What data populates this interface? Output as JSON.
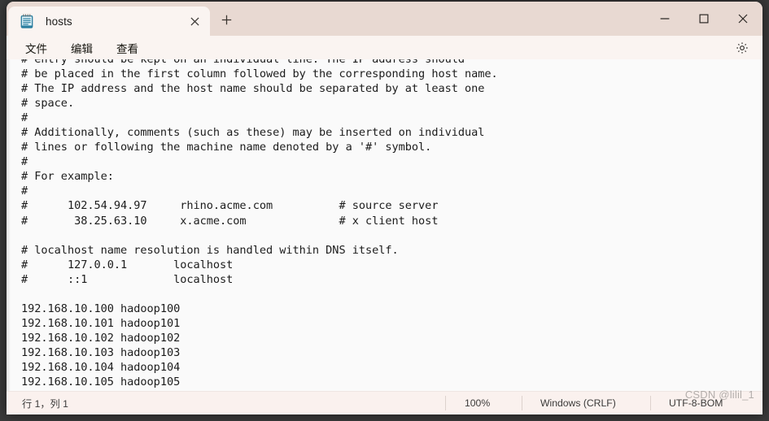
{
  "window": {
    "controls": {
      "minimize_label": "Minimize",
      "maximize_label": "Maximize",
      "close_label": "Close"
    }
  },
  "tabbar": {
    "tab_title": "hosts",
    "tab_close_label": "Close tab",
    "new_tab_label": "New tab",
    "app_icon": "notepad-icon"
  },
  "menubar": {
    "items": [
      {
        "label": "文件",
        "name": "file"
      },
      {
        "label": "编辑",
        "name": "edit"
      },
      {
        "label": "查看",
        "name": "view"
      }
    ],
    "settings_icon": "gear-icon"
  },
  "editor": {
    "lines": [
      "# entry should be kept on an individual line. The IP address should",
      "# be placed in the first column followed by the corresponding host name.",
      "# The IP address and the host name should be separated by at least one",
      "# space.",
      "#",
      "# Additionally, comments (such as these) may be inserted on individual",
      "# lines or following the machine name denoted by a '#' symbol.",
      "#",
      "# For example:",
      "#",
      "#      102.54.94.97     rhino.acme.com          # source server",
      "#       38.25.63.10     x.acme.com              # x client host",
      "",
      "# localhost name resolution is handled within DNS itself.",
      "#      127.0.0.1       localhost",
      "#      ::1             localhost",
      "",
      "192.168.10.100 hadoop100",
      "192.168.10.101 hadoop101",
      "192.168.10.102 hadoop102",
      "192.168.10.103 hadoop103",
      "192.168.10.104 hadoop104",
      "192.168.10.105 hadoop105"
    ]
  },
  "statusbar": {
    "position": "行 1，列 1",
    "zoom": "100%",
    "line_ending": "Windows (CRLF)",
    "encoding": "UTF-8-BOM"
  },
  "watermark": {
    "text": "CSDN @lilil_1"
  },
  "colors": {
    "titlebar": "#e8d9d2",
    "tab_active": "#faf4f1",
    "menubar": "#faf4f1",
    "editor_bg": "#fafafa",
    "statusbar": "#faf1ee",
    "text": "#1c1c1c"
  }
}
